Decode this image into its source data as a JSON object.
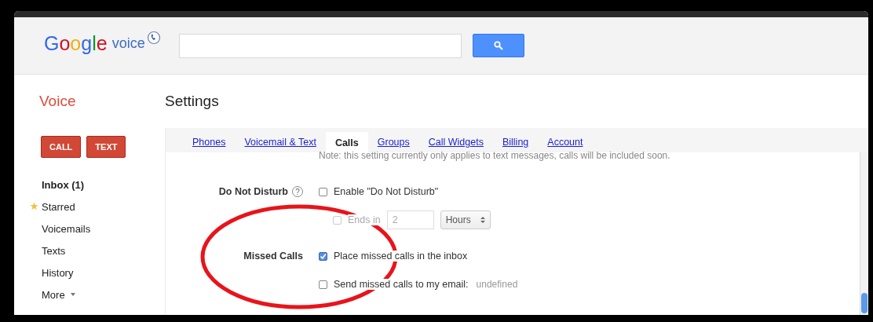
{
  "logo": {
    "brand": "Google",
    "product": "voice"
  },
  "app_title": "Voice",
  "page_title": "Settings",
  "actions": [
    {
      "label": "CALL"
    },
    {
      "label": "TEXT"
    }
  ],
  "sidebar": {
    "items": [
      {
        "label": "Inbox (1)",
        "kind": "plain",
        "selected": true
      },
      {
        "label": "Starred",
        "kind": "starred",
        "selected": false
      },
      {
        "label": "Voicemails",
        "kind": "plain",
        "selected": false
      },
      {
        "label": "Texts",
        "kind": "plain",
        "selected": false
      },
      {
        "label": "History",
        "kind": "plain",
        "selected": false
      },
      {
        "label": "More",
        "kind": "menu",
        "selected": false
      }
    ]
  },
  "tabs": [
    {
      "label": "Phones",
      "selected": false
    },
    {
      "label": "Voicemail & Text",
      "selected": false
    },
    {
      "label": "Calls",
      "selected": true
    },
    {
      "label": "Groups",
      "selected": false
    },
    {
      "label": "Call Widgets",
      "selected": false
    },
    {
      "label": "Billing",
      "selected": false
    },
    {
      "label": "Account",
      "selected": false
    }
  ],
  "note": "Note: this setting currently only applies to text messages, calls will be included soon.",
  "settings": [
    {
      "label": "Do Not Disturb",
      "help": "?",
      "options": [
        {
          "kind": "checkbox",
          "label": "Enable \"Do Not Disturb\"",
          "checked": false,
          "disabled": false
        },
        {
          "kind": "duration",
          "label": "Ends in",
          "checked": false,
          "disabled": true,
          "value": "2",
          "unit": "Hours"
        }
      ]
    },
    {
      "label": "Missed Calls",
      "options": [
        {
          "kind": "checkbox",
          "label": "Place missed calls in the inbox",
          "checked": true,
          "disabled": false
        },
        {
          "kind": "checkbox",
          "label": "Send missed calls to my email:",
          "detail": "undefined",
          "checked": false,
          "disabled": false
        }
      ]
    }
  ],
  "annotations": [
    {
      "kind": "ellipse"
    }
  ]
}
